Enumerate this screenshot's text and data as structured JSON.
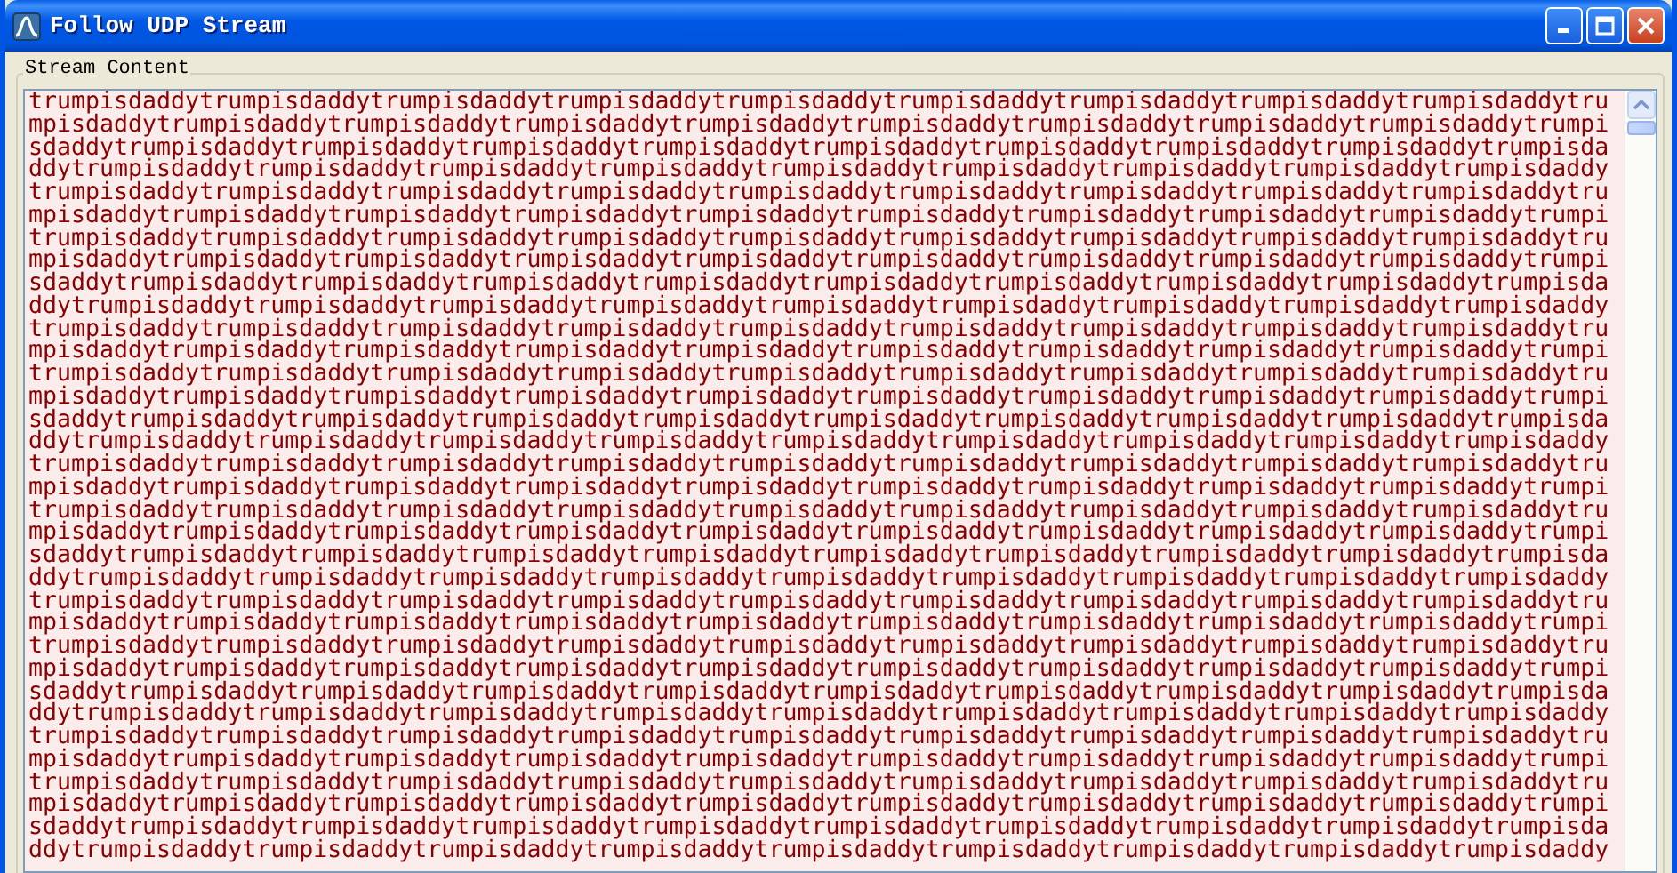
{
  "window": {
    "title": "Follow UDP Stream"
  },
  "stream_content": {
    "label": "Stream Content",
    "lines": [
      "trumpisdaddytrumpisdaddytrumpisdaddytrumpisdaddytrumpisdaddytrumpisdaddytrumpisdaddytrumpisdaddytrumpisdaddytru",
      "mpisdaddytrumpisdaddytrumpisdaddytrumpisdaddytrumpisdaddytrumpisdaddytrumpisdaddytrumpisdaddytrumpisdaddytrumpi",
      "sdaddytrumpisdaddytrumpisdaddytrumpisdaddytrumpisdaddytrumpisdaddytrumpisdaddytrumpisdaddytrumpisdaddytrumpisda",
      "ddytrumpisdaddytrumpisdaddytrumpisdaddytrumpisdaddytrumpisdaddytrumpisdaddytrumpisdaddytrumpisdaddytrumpisdaddy",
      "trumpisdaddytrumpisdaddytrumpisdaddytrumpisdaddytrumpisdaddytrumpisdaddytrumpisdaddytrumpisdaddytrumpisdaddytru",
      "mpisdaddytrumpisdaddytrumpisdaddytrumpisdaddytrumpisdaddytrumpisdaddytrumpisdaddytrumpisdaddytrumpisdaddytrumpi",
      "trumpisdaddytrumpisdaddytrumpisdaddytrumpisdaddytrumpisdaddytrumpisdaddytrumpisdaddytrumpisdaddytrumpisdaddytru",
      "mpisdaddytrumpisdaddytrumpisdaddytrumpisdaddytrumpisdaddytrumpisdaddytrumpisdaddytrumpisdaddytrumpisdaddytrumpi",
      "sdaddytrumpisdaddytrumpisdaddytrumpisdaddytrumpisdaddytrumpisdaddytrumpisdaddytrumpisdaddytrumpisdaddytrumpisda",
      "ddytrumpisdaddytrumpisdaddytrumpisdaddytrumpisdaddytrumpisdaddytrumpisdaddytrumpisdaddytrumpisdaddytrumpisdaddy",
      "trumpisdaddytrumpisdaddytrumpisdaddytrumpisdaddytrumpisdaddytrumpisdaddytrumpisdaddytrumpisdaddytrumpisdaddytru",
      "mpisdaddytrumpisdaddytrumpisdaddytrumpisdaddytrumpisdaddytrumpisdaddytrumpisdaddytrumpisdaddytrumpisdaddytrumpi",
      "trumpisdaddytrumpisdaddytrumpisdaddytrumpisdaddytrumpisdaddytrumpisdaddytrumpisdaddytrumpisdaddytrumpisdaddytru",
      "mpisdaddytrumpisdaddytrumpisdaddytrumpisdaddytrumpisdaddytrumpisdaddytrumpisdaddytrumpisdaddytrumpisdaddytrumpi",
      "sdaddytrumpisdaddytrumpisdaddytrumpisdaddytrumpisdaddytrumpisdaddytrumpisdaddytrumpisdaddytrumpisdaddytrumpisda",
      "ddytrumpisdaddytrumpisdaddytrumpisdaddytrumpisdaddytrumpisdaddytrumpisdaddytrumpisdaddytrumpisdaddytrumpisdaddy",
      "trumpisdaddytrumpisdaddytrumpisdaddytrumpisdaddytrumpisdaddytrumpisdaddytrumpisdaddytrumpisdaddytrumpisdaddytru",
      "mpisdaddytrumpisdaddytrumpisdaddytrumpisdaddytrumpisdaddytrumpisdaddytrumpisdaddytrumpisdaddytrumpisdaddytrumpi",
      "trumpisdaddytrumpisdaddytrumpisdaddytrumpisdaddytrumpisdaddytrumpisdaddytrumpisdaddytrumpisdaddytrumpisdaddytru",
      "mpisdaddytrumpisdaddytrumpisdaddytrumpisdaddytrumpisdaddytrumpisdaddytrumpisdaddytrumpisdaddytrumpisdaddytrumpi",
      "sdaddytrumpisdaddytrumpisdaddytrumpisdaddytrumpisdaddytrumpisdaddytrumpisdaddytrumpisdaddytrumpisdaddytrumpisda",
      "ddytrumpisdaddytrumpisdaddytrumpisdaddytrumpisdaddytrumpisdaddytrumpisdaddytrumpisdaddytrumpisdaddytrumpisdaddy",
      "trumpisdaddytrumpisdaddytrumpisdaddytrumpisdaddytrumpisdaddytrumpisdaddytrumpisdaddytrumpisdaddytrumpisdaddytru",
      "mpisdaddytrumpisdaddytrumpisdaddytrumpisdaddytrumpisdaddytrumpisdaddytrumpisdaddytrumpisdaddytrumpisdaddytrumpi",
      "trumpisdaddytrumpisdaddytrumpisdaddytrumpisdaddytrumpisdaddytrumpisdaddytrumpisdaddytrumpisdaddytrumpisdaddytru",
      "mpisdaddytrumpisdaddytrumpisdaddytrumpisdaddytrumpisdaddytrumpisdaddytrumpisdaddytrumpisdaddytrumpisdaddytrumpi",
      "sdaddytrumpisdaddytrumpisdaddytrumpisdaddytrumpisdaddytrumpisdaddytrumpisdaddytrumpisdaddytrumpisdaddytrumpisda",
      "ddytrumpisdaddytrumpisdaddytrumpisdaddytrumpisdaddytrumpisdaddytrumpisdaddytrumpisdaddytrumpisdaddytrumpisdaddy",
      "trumpisdaddytrumpisdaddytrumpisdaddytrumpisdaddytrumpisdaddytrumpisdaddytrumpisdaddytrumpisdaddytrumpisdaddytru",
      "mpisdaddytrumpisdaddytrumpisdaddytrumpisdaddytrumpisdaddytrumpisdaddytrumpisdaddytrumpisdaddytrumpisdaddytrumpi",
      "trumpisdaddytrumpisdaddytrumpisdaddytrumpisdaddytrumpisdaddytrumpisdaddytrumpisdaddytrumpisdaddytrumpisdaddytru",
      "mpisdaddytrumpisdaddytrumpisdaddytrumpisdaddytrumpisdaddytrumpisdaddytrumpisdaddytrumpisdaddytrumpisdaddytrumpi",
      "sdaddytrumpisdaddytrumpisdaddytrumpisdaddytrumpisdaddytrumpisdaddytrumpisdaddytrumpisdaddytrumpisdaddytrumpisda",
      "ddytrumpisdaddytrumpisdaddytrumpisdaddytrumpisdaddytrumpisdaddytrumpisdaddytrumpisdaddytrumpisdaddytrumpisdaddy"
    ]
  }
}
